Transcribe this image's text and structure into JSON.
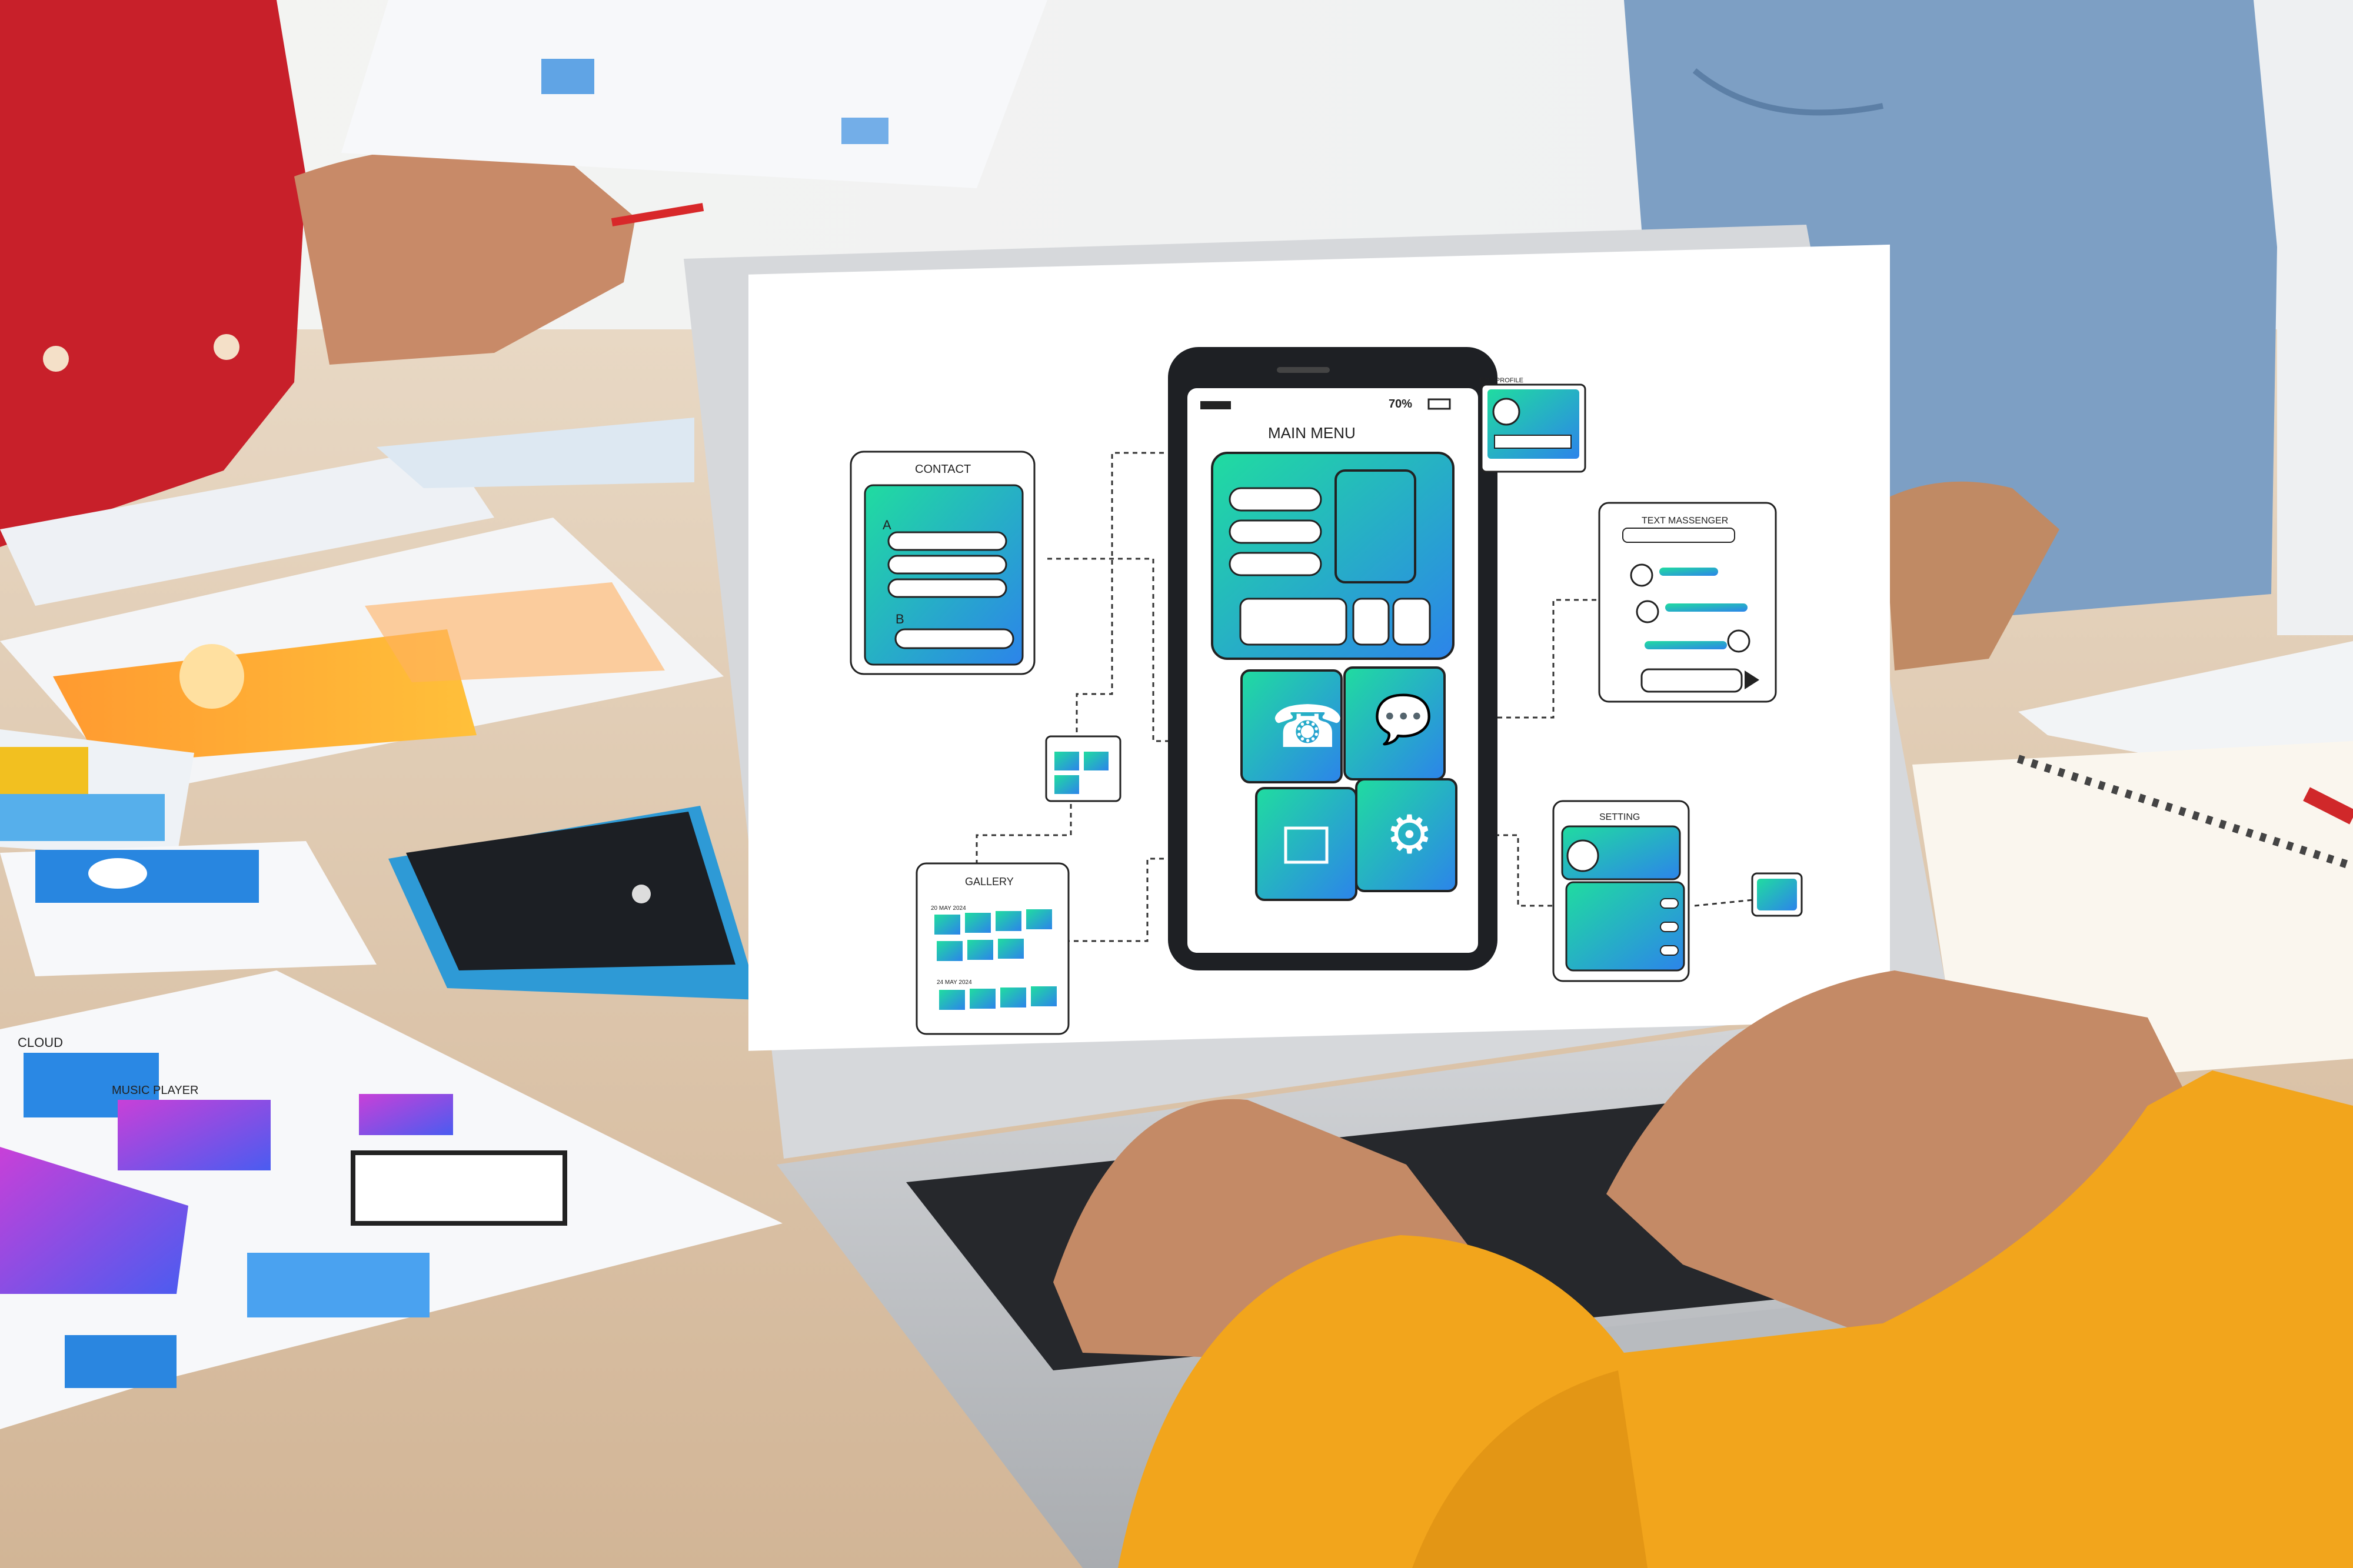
{
  "wireframe": {
    "main_menu": {
      "title": "MAIN MENU",
      "battery": "70%"
    },
    "edit_profile": {
      "title": "EDIT PROFILE"
    },
    "contact": {
      "title": "CONTACT",
      "section_a": "A",
      "section_b": "B"
    },
    "text_messenger": {
      "title": "TEXT MASSENGER"
    },
    "gallery": {
      "title": "GALLERY",
      "date_1": "20 MAY 2024",
      "date_2": "24 MAY 2024"
    },
    "setting": {
      "title": "SETTING"
    }
  },
  "desk_papers": {
    "cloud": "CLOUD",
    "music_player": "MUSIC PLAYER"
  },
  "colors": {
    "gradient_start": "#1fd8a0",
    "gradient_end": "#2a86e8",
    "shirt_red": "#c8202a",
    "sleeve_yellow": "#f2a51c",
    "jeans_blue": "#7d9fc4"
  }
}
